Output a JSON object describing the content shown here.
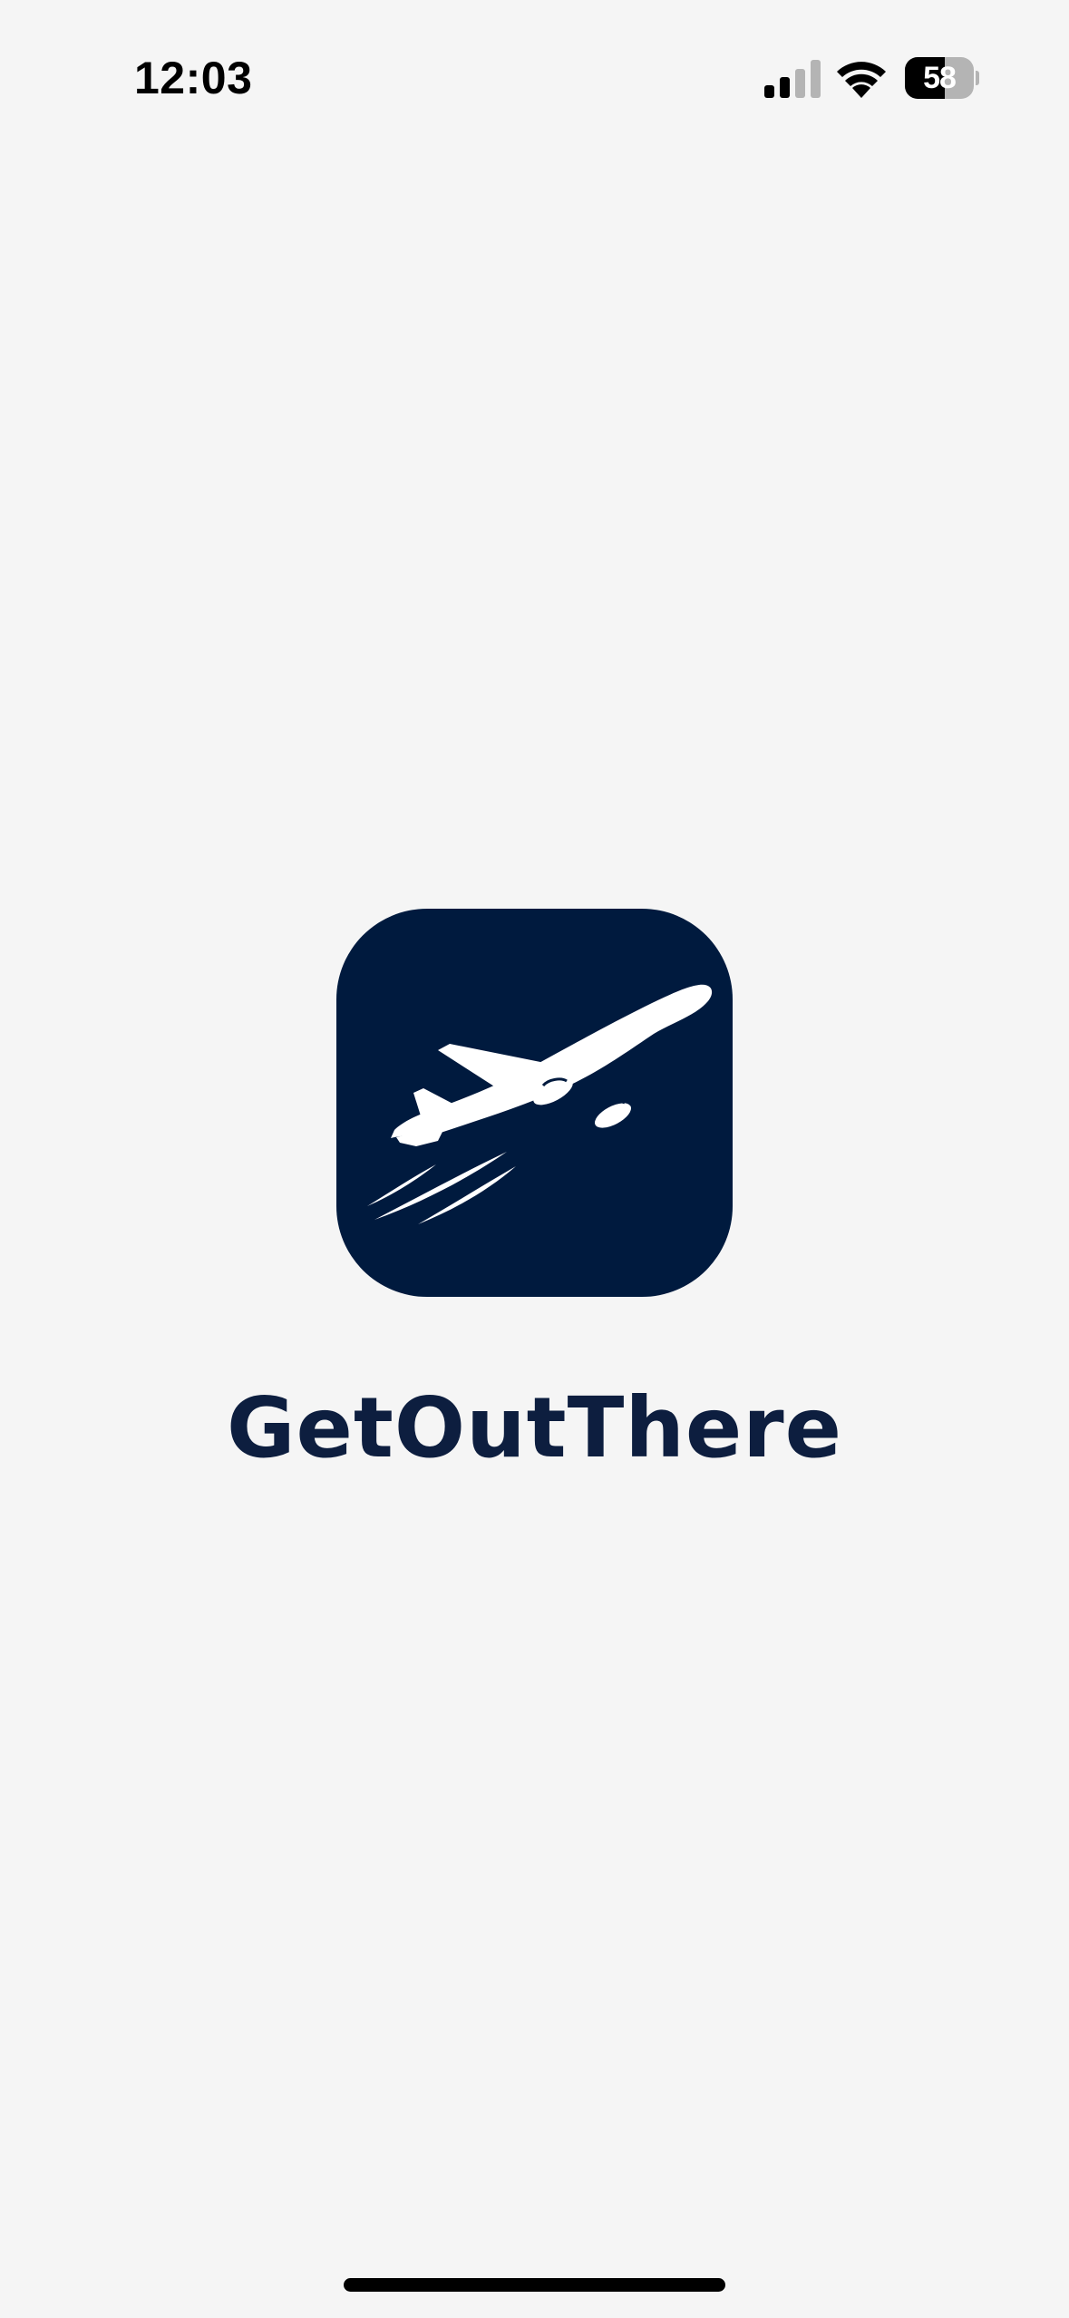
{
  "status_bar": {
    "time": "12:03",
    "battery_level": "58",
    "battery_fraction": 0.58,
    "signal_bars_active": 2,
    "signal_bars_total": 4,
    "icons": [
      "cellular-signal-icon",
      "wifi-icon",
      "battery-icon"
    ]
  },
  "splash": {
    "app_name": "GetOutThere",
    "logo_icon": "airplane-takeoff-icon",
    "colors": {
      "background": "#f5f5f5",
      "icon_background": "#001a3e",
      "icon_foreground": "#ffffff",
      "title": "#0d1e3f"
    }
  }
}
